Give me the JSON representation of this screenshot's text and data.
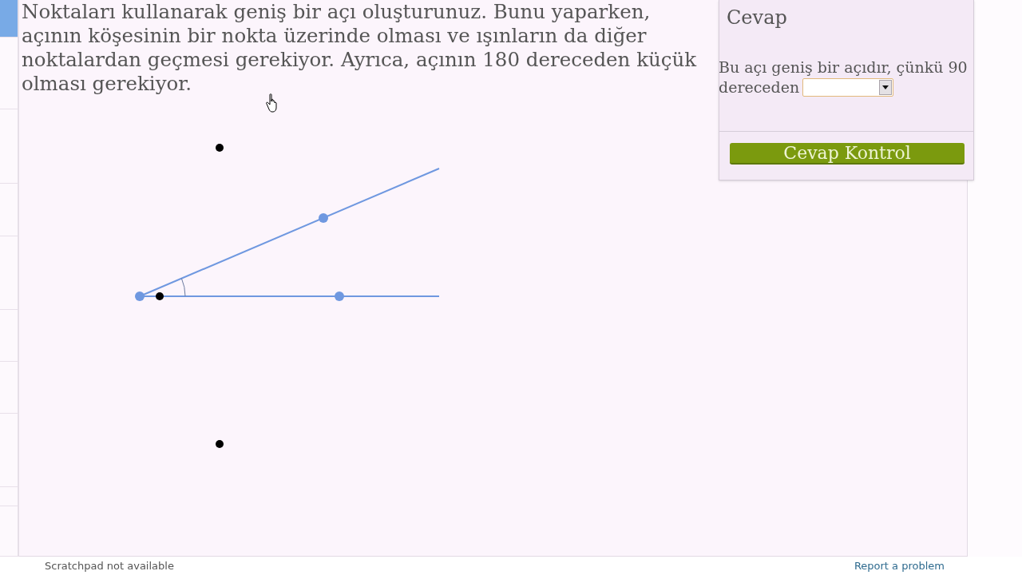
{
  "sidebar": {
    "items": [
      {
        "selected": true
      },
      {
        "selected": false
      },
      {
        "selected": false
      },
      {
        "selected": false
      },
      {
        "selected": false
      },
      {
        "selected": false
      },
      {
        "selected": false
      },
      {
        "selected": false
      },
      {
        "selected": false
      },
      {
        "selected": false
      }
    ]
  },
  "question": {
    "text": "Noktaları kullanarak geniş bir açı oluşturunuz. Bunu yaparken, açının köşesinin bir nokta üzerinde olması ve ışınların da diğer noktalardan geçmesi gerekiyor. Ayrıca, açının 180 dereceden küçük olması gerekiyor."
  },
  "answer_panel": {
    "title": "Cevap",
    "prompt_lines": [
      "Bu açı geniş bir açıdır, çünkü 90",
      "dereceden"
    ],
    "check_button": "Cevap Kontrol"
  },
  "footer": {
    "scratchpad_note": "Scratchpad not available",
    "report_link": "Report a problem"
  }
}
